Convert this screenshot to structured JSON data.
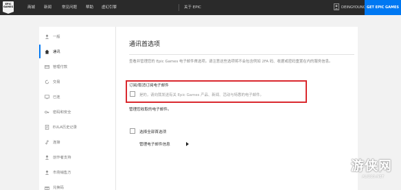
{
  "topnav": {
    "logo_text": "EPIC GAMES",
    "items": [
      "商城",
      "新闻",
      "常见问题",
      "帮助",
      "虚幻引擎"
    ],
    "about": "关于 EPIC",
    "username": "DEINGYOUNG",
    "cta": "GET EPIC GAMES"
  },
  "sidebar": {
    "items": [
      {
        "label": "一般",
        "icon": "user-icon"
      },
      {
        "label": "通讯",
        "icon": "home-icon",
        "active": true
      },
      {
        "label": "管理付款",
        "icon": "card-icon"
      },
      {
        "label": "交易",
        "icon": "refresh-icon"
      },
      {
        "label": "已连",
        "icon": "screen-icon"
      },
      {
        "label": "密码和安全",
        "icon": "key-icon"
      },
      {
        "label": "EULA历史记录",
        "icon": "document-icon"
      },
      {
        "label": "连接",
        "icon": "link-icon"
      },
      {
        "label": "创作者支持",
        "icon": "user-icon"
      },
      {
        "label": "市场销售方",
        "icon": "user-icon"
      },
      {
        "label": "兑换码",
        "icon": "gift-icon"
      }
    ]
  },
  "main": {
    "title": "通讯首选项",
    "description": "查看并管理您的 Epic Games 电子邮件首选项。请注意这些选项将不会包含例如 2FA 码、收据或密码重置在内的服务信息。",
    "subscribe_title": "订阅/取消订阅电子邮件",
    "subscribe_option": "是的，请向我发送有关 Epic Games 产品、新闻、活动与特惠的电子邮件。",
    "manage_text": "管理您收取的电子邮件。",
    "select_all": "选择全部首选项",
    "manage_info": "管理电子邮件信息"
  },
  "watermark": {
    "text": "游侠网",
    "sub": "ALI213.NET"
  },
  "colors": {
    "accent": "#0078f2",
    "highlight_border": "#d9262c",
    "topbar": "#2a2a2a"
  }
}
